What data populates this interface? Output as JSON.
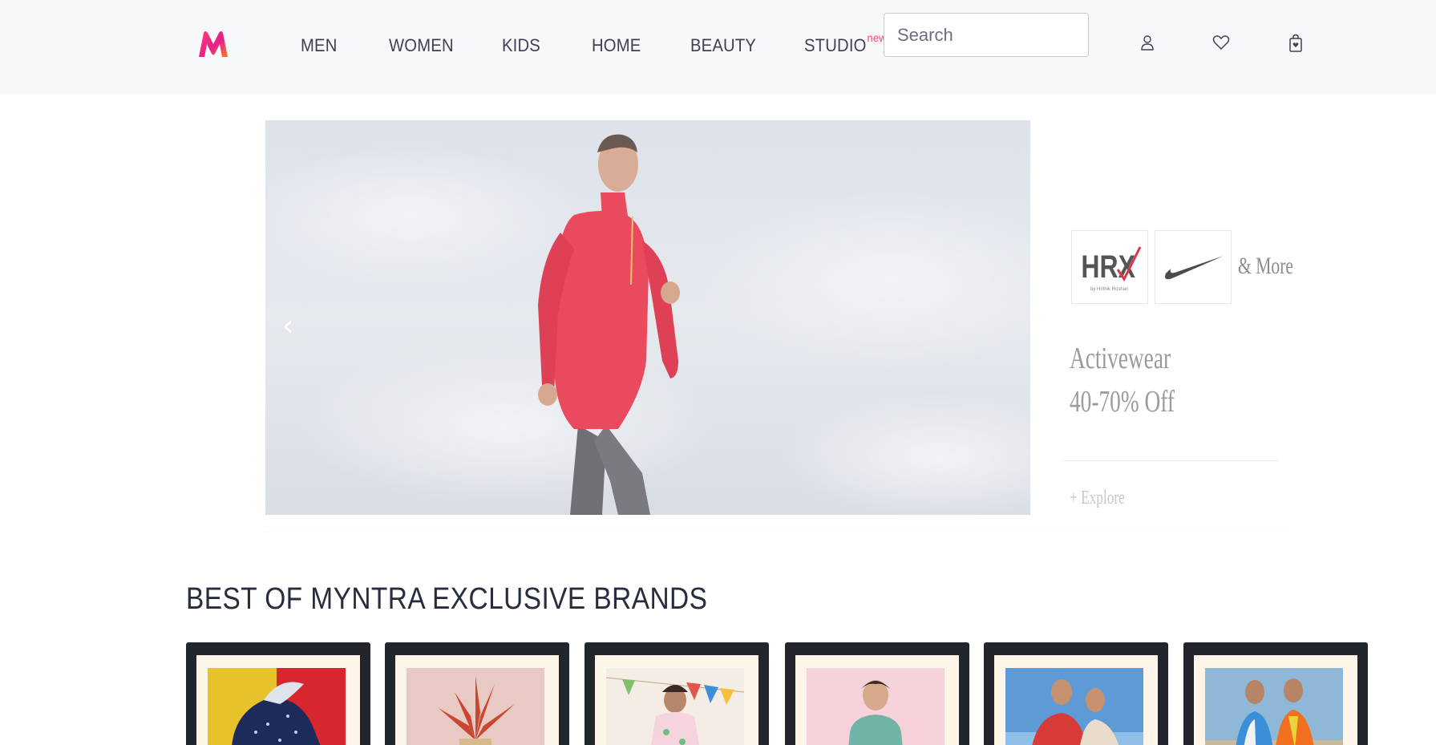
{
  "header": {
    "logo": {
      "name": "myntra-logo",
      "colors": [
        "#ff3f6c",
        "#f47c20",
        "#e91e8c"
      ]
    },
    "nav": [
      {
        "label": "MEN"
      },
      {
        "label": "WOMEN"
      },
      {
        "label": "KIDS"
      },
      {
        "label": "HOME"
      },
      {
        "label": "BEAUTY"
      },
      {
        "label": "STUDIO",
        "badge": "new"
      }
    ],
    "search": {
      "placeholder": "Search",
      "value": ""
    },
    "icons": [
      "profile-icon",
      "wishlist-heart-icon",
      "bag-icon"
    ]
  },
  "carousel": {
    "prev_arrow": "‹",
    "promo": {
      "brands": [
        "HRX",
        "Nike"
      ],
      "and_more": "& More",
      "title_line1": "Activewear",
      "title_line2": "40-70% Off",
      "explore": "+ Explore"
    }
  },
  "section": {
    "title": "BEST OF MYNTRA EXCLUSIVE BRANDS",
    "cards": [
      {
        "name": "card-shoes"
      },
      {
        "name": "card-home-decor"
      },
      {
        "name": "card-kids-party"
      },
      {
        "name": "card-kids-boy"
      },
      {
        "name": "card-men-ethnic"
      },
      {
        "name": "card-men-casual"
      }
    ]
  },
  "colors": {
    "accent": "#ff3f6c",
    "header_bg": "#f7f8fa",
    "card_frame": "#22262c"
  }
}
